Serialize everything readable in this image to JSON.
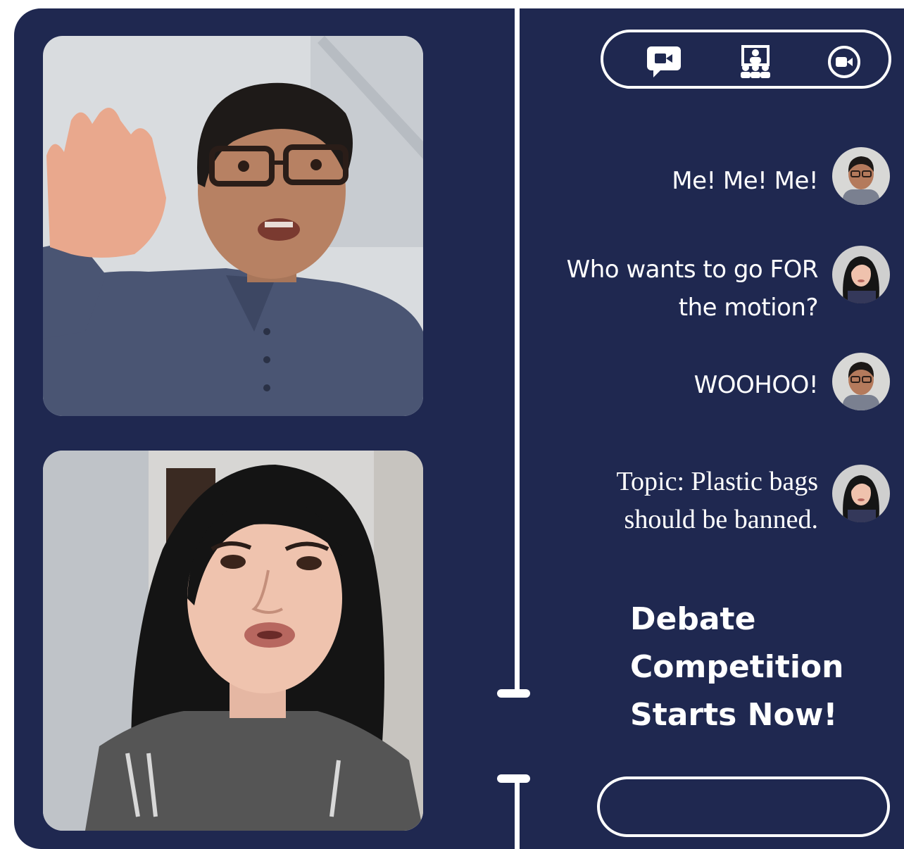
{
  "toolbar": {
    "icons": [
      "chat-icon",
      "group-icon",
      "video-camera-icon"
    ]
  },
  "messages": [
    {
      "text": "Me! Me! Me!",
      "speaker": "boy"
    },
    {
      "text": "Who wants to go FOR the motion?",
      "speaker": "woman"
    },
    {
      "text": "WOOHOO!",
      "speaker": "boy"
    },
    {
      "text": "Topic: Plastic bags should be banned.",
      "speaker": "woman"
    }
  ],
  "headline": {
    "line1": "Debate",
    "line2": "Competition",
    "line3": "Starts Now!"
  },
  "colors": {
    "panel": "#1f2850",
    "foreground": "#ffffff"
  }
}
